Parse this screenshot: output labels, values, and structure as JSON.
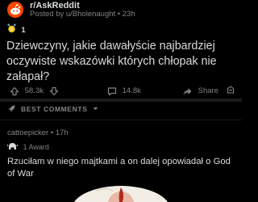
{
  "header": {
    "subreddit": "r/AskReddit",
    "meta": "Posted by u/Bholenaught • 23h"
  },
  "post": {
    "award_count": "1",
    "title": "Dziewczyny, jakie dawałyście najbardziej oczywiste wskazówki których chłopak nie załapał?"
  },
  "actions": {
    "upvotes": "58.3k",
    "comments": "14.8k",
    "share_label": "Share"
  },
  "sort": {
    "label": "BEST COMMENTS"
  },
  "comment": {
    "meta": "cattoepicker • 17h",
    "award_label": "1 Award",
    "body": "Rzuciłam w niego majtkami a on dalej opowiadał o God of War"
  },
  "icons": {
    "subreddit": "reddit-snoo-icon",
    "award": "award-icon",
    "upvote": "upvote-arrow-icon",
    "downvote": "downvote-arrow-icon",
    "comments": "comment-bubble-icon",
    "share": "share-arrow-icon",
    "sort": "rocket-icon",
    "sort_dropdown": "chevron-down-icon",
    "comment_award": "helmet-award-icon",
    "more": "more-icon"
  },
  "colors": {
    "background": "#000000",
    "text": "#d7dadc",
    "muted": "#818384",
    "brand": "#ff4500",
    "separator": "#1a1a1b"
  }
}
